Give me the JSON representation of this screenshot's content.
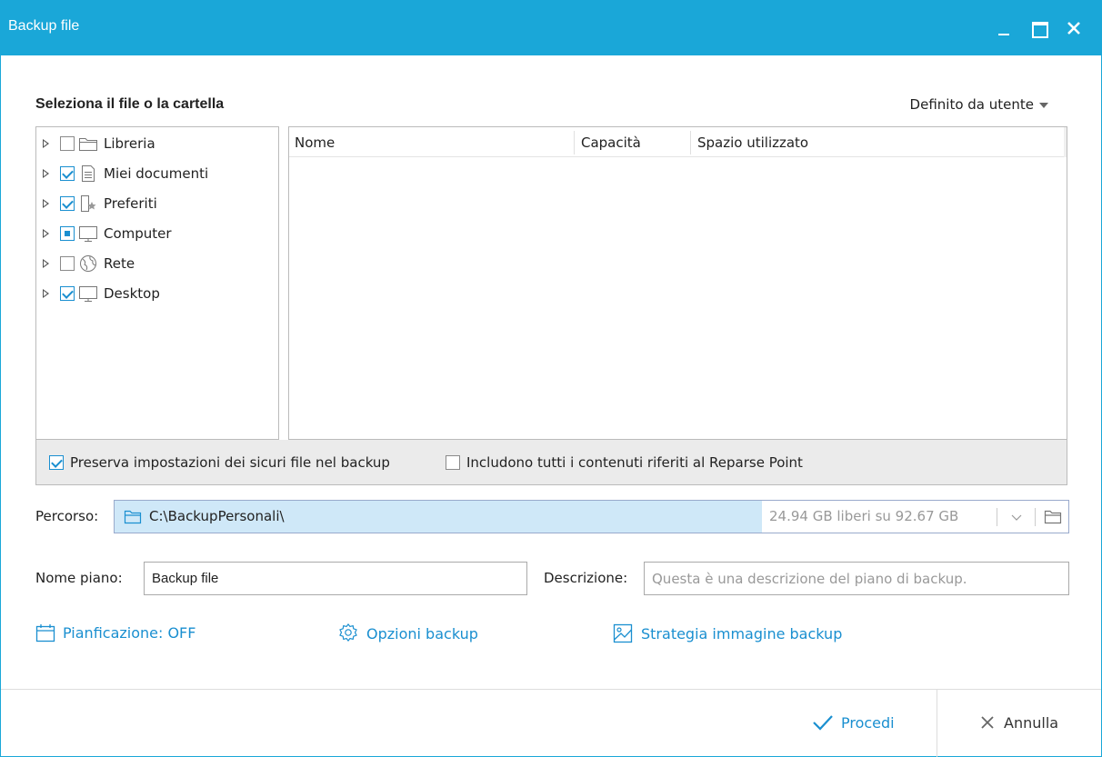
{
  "window": {
    "title": "Backup file"
  },
  "header": {
    "section_title": "Seleziona il file o la cartella",
    "view_mode": "Definito da utente"
  },
  "tree": {
    "items": [
      {
        "label": "Libreria",
        "state": "unchecked",
        "icon": "folder-icon"
      },
      {
        "label": "Miei documenti",
        "state": "checked",
        "icon": "document-icon"
      },
      {
        "label": "Preferiti",
        "state": "checked",
        "icon": "favorites-icon"
      },
      {
        "label": "Computer",
        "state": "partial",
        "icon": "monitor-icon"
      },
      {
        "label": "Rete",
        "state": "unchecked",
        "icon": "network-icon"
      },
      {
        "label": "Desktop",
        "state": "checked",
        "icon": "monitor-icon"
      }
    ]
  },
  "filelist": {
    "columns": [
      "Nome",
      "Capacità",
      "Spazio utilizzato"
    ]
  },
  "options": {
    "preserve_security": {
      "label": "Preserva impostazioni dei sicuri file nel backup",
      "checked": true
    },
    "reparse_point": {
      "label": "Includono tutti i contenuti riferiti al Reparse Point",
      "checked": false
    }
  },
  "path": {
    "label": "Percorso:",
    "value": "C:\\BackupPersonali\\",
    "free_space": "24.94 GB liberi su 92.67 GB"
  },
  "plan": {
    "name_label": "Nome piano:",
    "name_value": "Backup file",
    "desc_label": "Descrizione:",
    "desc_placeholder": "Questa è una descrizione del piano di backup."
  },
  "links": {
    "schedule": "Pianficazione: OFF",
    "options": "Opzioni backup",
    "image_strategy": "Strategia immagine backup"
  },
  "footer": {
    "proceed": "Procedi",
    "cancel": "Annulla"
  },
  "colors": {
    "accent": "#1aa7d8",
    "link": "#1a8fd0",
    "path_bg": "#cfe8f8"
  }
}
